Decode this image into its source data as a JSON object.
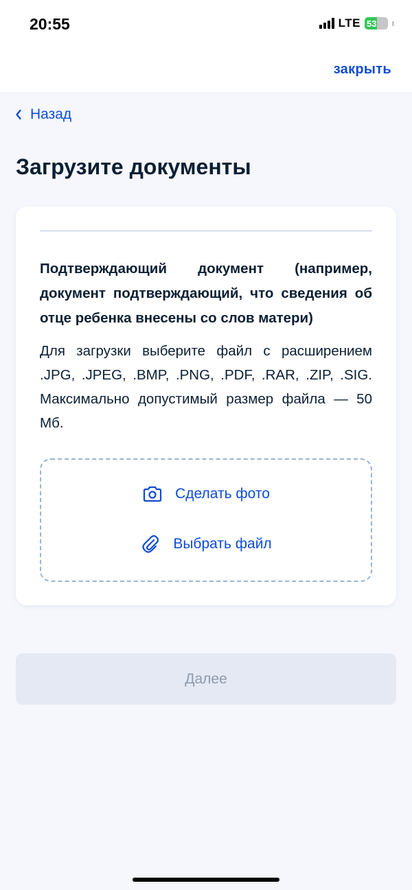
{
  "status_bar": {
    "time": "20:55",
    "network": "LTE",
    "battery": "53",
    "battery_level_percent": 53
  },
  "header": {
    "close_label": "закрыть"
  },
  "nav": {
    "back_label": "Назад"
  },
  "page": {
    "title": "Загрузите документы"
  },
  "document": {
    "title": "Подтверждающий документ (например, документ подтверждающий, что сведения об отце ребенка внесены со слов матери)",
    "description": "Для загрузки выберите файл с расширением .JPG, .JPEG, .BMP, .PNG, .PDF, .RAR, .ZIP, .SIG. Максимально допустимый размер файла — 50 Мб."
  },
  "upload": {
    "take_photo_label": "Сделать фото",
    "choose_file_label": "Выбрать файл",
    "take_photo_icon": "camera-icon",
    "choose_file_icon": "paperclip-icon"
  },
  "footer": {
    "next_label": "Далее"
  },
  "colors": {
    "accent": "#0d4cd3",
    "background": "#f5f7fd",
    "card": "#ffffff",
    "disabled_button": "#e4e9f3",
    "disabled_text": "#8e9aab",
    "dashed_border": "#9bb2d4",
    "battery_green": "#34c759"
  }
}
